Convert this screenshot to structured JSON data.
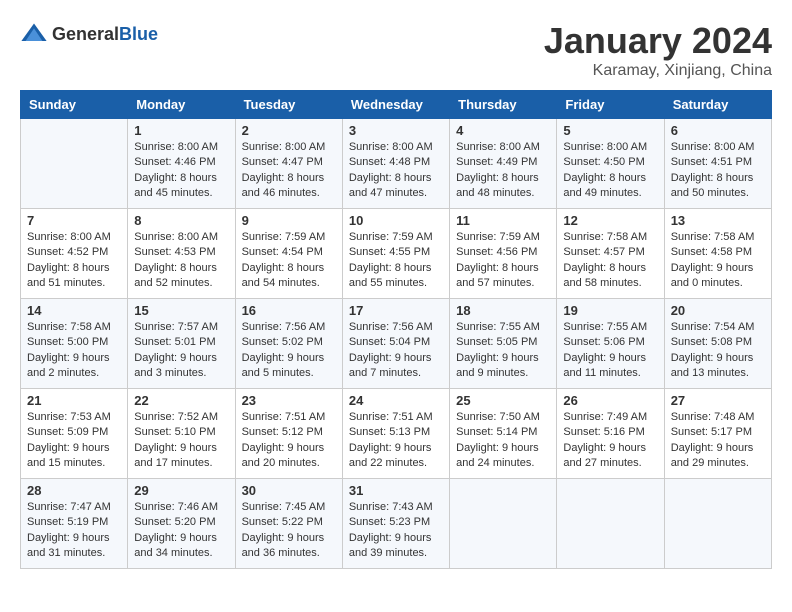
{
  "logo": {
    "general": "General",
    "blue": "Blue"
  },
  "header": {
    "month": "January 2024",
    "location": "Karamay, Xinjiang, China"
  },
  "weekdays": [
    "Sunday",
    "Monday",
    "Tuesday",
    "Wednesday",
    "Thursday",
    "Friday",
    "Saturday"
  ],
  "weeks": [
    [
      {
        "day": "",
        "info": ""
      },
      {
        "day": "1",
        "info": "Sunrise: 8:00 AM\nSunset: 4:46 PM\nDaylight: 8 hours\nand 45 minutes."
      },
      {
        "day": "2",
        "info": "Sunrise: 8:00 AM\nSunset: 4:47 PM\nDaylight: 8 hours\nand 46 minutes."
      },
      {
        "day": "3",
        "info": "Sunrise: 8:00 AM\nSunset: 4:48 PM\nDaylight: 8 hours\nand 47 minutes."
      },
      {
        "day": "4",
        "info": "Sunrise: 8:00 AM\nSunset: 4:49 PM\nDaylight: 8 hours\nand 48 minutes."
      },
      {
        "day": "5",
        "info": "Sunrise: 8:00 AM\nSunset: 4:50 PM\nDaylight: 8 hours\nand 49 minutes."
      },
      {
        "day": "6",
        "info": "Sunrise: 8:00 AM\nSunset: 4:51 PM\nDaylight: 8 hours\nand 50 minutes."
      }
    ],
    [
      {
        "day": "7",
        "info": "Sunrise: 8:00 AM\nSunset: 4:52 PM\nDaylight: 8 hours\nand 51 minutes."
      },
      {
        "day": "8",
        "info": "Sunrise: 8:00 AM\nSunset: 4:53 PM\nDaylight: 8 hours\nand 52 minutes."
      },
      {
        "day": "9",
        "info": "Sunrise: 7:59 AM\nSunset: 4:54 PM\nDaylight: 8 hours\nand 54 minutes."
      },
      {
        "day": "10",
        "info": "Sunrise: 7:59 AM\nSunset: 4:55 PM\nDaylight: 8 hours\nand 55 minutes."
      },
      {
        "day": "11",
        "info": "Sunrise: 7:59 AM\nSunset: 4:56 PM\nDaylight: 8 hours\nand 57 minutes."
      },
      {
        "day": "12",
        "info": "Sunrise: 7:58 AM\nSunset: 4:57 PM\nDaylight: 8 hours\nand 58 minutes."
      },
      {
        "day": "13",
        "info": "Sunrise: 7:58 AM\nSunset: 4:58 PM\nDaylight: 9 hours\nand 0 minutes."
      }
    ],
    [
      {
        "day": "14",
        "info": "Sunrise: 7:58 AM\nSunset: 5:00 PM\nDaylight: 9 hours\nand 2 minutes."
      },
      {
        "day": "15",
        "info": "Sunrise: 7:57 AM\nSunset: 5:01 PM\nDaylight: 9 hours\nand 3 minutes."
      },
      {
        "day": "16",
        "info": "Sunrise: 7:56 AM\nSunset: 5:02 PM\nDaylight: 9 hours\nand 5 minutes."
      },
      {
        "day": "17",
        "info": "Sunrise: 7:56 AM\nSunset: 5:04 PM\nDaylight: 9 hours\nand 7 minutes."
      },
      {
        "day": "18",
        "info": "Sunrise: 7:55 AM\nSunset: 5:05 PM\nDaylight: 9 hours\nand 9 minutes."
      },
      {
        "day": "19",
        "info": "Sunrise: 7:55 AM\nSunset: 5:06 PM\nDaylight: 9 hours\nand 11 minutes."
      },
      {
        "day": "20",
        "info": "Sunrise: 7:54 AM\nSunset: 5:08 PM\nDaylight: 9 hours\nand 13 minutes."
      }
    ],
    [
      {
        "day": "21",
        "info": "Sunrise: 7:53 AM\nSunset: 5:09 PM\nDaylight: 9 hours\nand 15 minutes."
      },
      {
        "day": "22",
        "info": "Sunrise: 7:52 AM\nSunset: 5:10 PM\nDaylight: 9 hours\nand 17 minutes."
      },
      {
        "day": "23",
        "info": "Sunrise: 7:51 AM\nSunset: 5:12 PM\nDaylight: 9 hours\nand 20 minutes."
      },
      {
        "day": "24",
        "info": "Sunrise: 7:51 AM\nSunset: 5:13 PM\nDaylight: 9 hours\nand 22 minutes."
      },
      {
        "day": "25",
        "info": "Sunrise: 7:50 AM\nSunset: 5:14 PM\nDaylight: 9 hours\nand 24 minutes."
      },
      {
        "day": "26",
        "info": "Sunrise: 7:49 AM\nSunset: 5:16 PM\nDaylight: 9 hours\nand 27 minutes."
      },
      {
        "day": "27",
        "info": "Sunrise: 7:48 AM\nSunset: 5:17 PM\nDaylight: 9 hours\nand 29 minutes."
      }
    ],
    [
      {
        "day": "28",
        "info": "Sunrise: 7:47 AM\nSunset: 5:19 PM\nDaylight: 9 hours\nand 31 minutes."
      },
      {
        "day": "29",
        "info": "Sunrise: 7:46 AM\nSunset: 5:20 PM\nDaylight: 9 hours\nand 34 minutes."
      },
      {
        "day": "30",
        "info": "Sunrise: 7:45 AM\nSunset: 5:22 PM\nDaylight: 9 hours\nand 36 minutes."
      },
      {
        "day": "31",
        "info": "Sunrise: 7:43 AM\nSunset: 5:23 PM\nDaylight: 9 hours\nand 39 minutes."
      },
      {
        "day": "",
        "info": ""
      },
      {
        "day": "",
        "info": ""
      },
      {
        "day": "",
        "info": ""
      }
    ]
  ]
}
